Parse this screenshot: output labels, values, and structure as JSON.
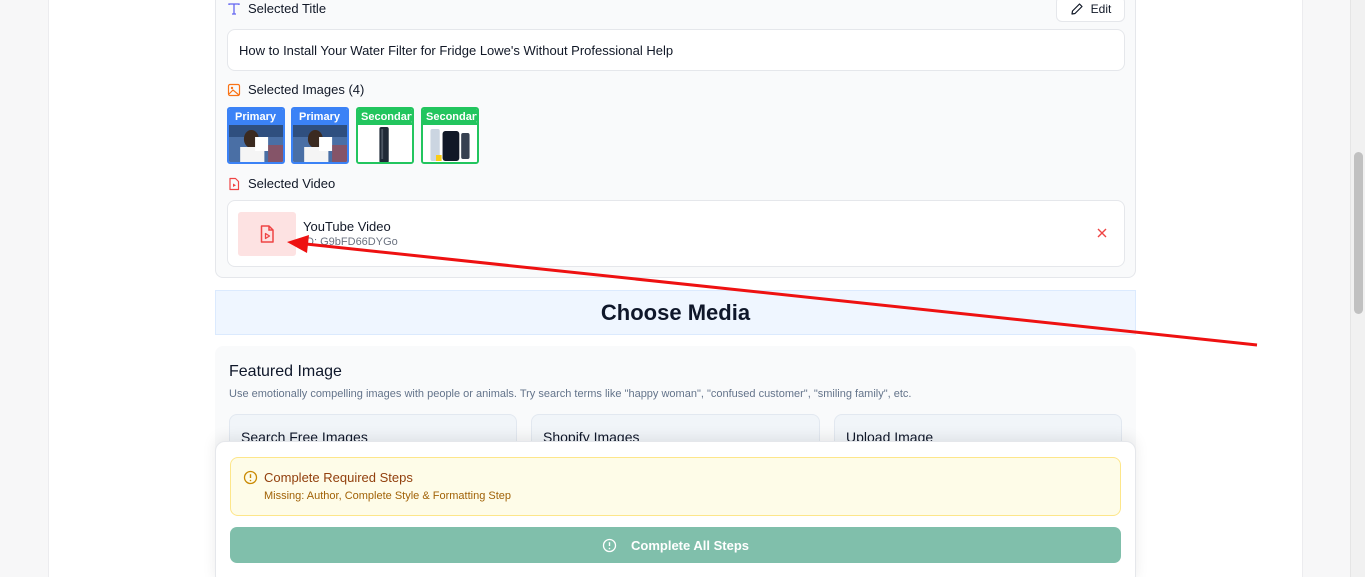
{
  "summary": {
    "title_heading": "Selected Title",
    "edit_label": "Edit",
    "selected_title": "How to Install Your Water Filter for Fridge Lowe's Without Professional Help",
    "images_heading": "Selected Images (4)",
    "images": [
      {
        "tag": "Primary",
        "type": "person-photo"
      },
      {
        "tag": "Primary",
        "type": "person-photo"
      },
      {
        "tag": "Secondary",
        "type": "filter-cartridge"
      },
      {
        "tag": "Secondary",
        "type": "filter-product"
      }
    ],
    "video_heading": "Selected Video",
    "video": {
      "title": "YouTube Video",
      "id_text": "ID: G9bFD66DYGo"
    }
  },
  "choose_media": {
    "heading": "Choose Media"
  },
  "featured": {
    "title": "Featured Image",
    "description": "Use emotionally compelling images with people or animals. Try search terms like \"happy woman\", \"confused customer\", \"smiling family\", etc.",
    "options": [
      {
        "label": "Search Free Images"
      },
      {
        "label": "Shopify Images"
      },
      {
        "label": "Upload Image"
      }
    ]
  },
  "warning": {
    "title": "Complete Required Steps",
    "missing": "Missing: Author, Complete Style & Formatting Step"
  },
  "action": {
    "complete_label": "Complete All Steps"
  },
  "colors": {
    "primary_tag": "#3b82f6",
    "secondary_tag": "#22c55e",
    "annotation_arrow": "#ee1111",
    "complete_button": "#80bfab",
    "warning_bg": "#fefce8"
  },
  "icons": [
    "type-icon",
    "pencil-icon",
    "image-icon",
    "video-file-icon",
    "close-icon",
    "alert-circle-icon"
  ]
}
